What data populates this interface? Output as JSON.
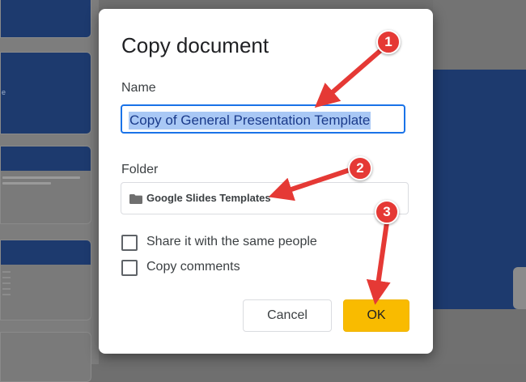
{
  "background": {
    "thumbnail_title_fragment": "e"
  },
  "dialog": {
    "title": "Copy document",
    "name_label": "Name",
    "name_value": "Copy of General Presentation Template",
    "folder_label": "Folder",
    "folder_icon": "folder-icon",
    "folder_value": "Google Slides Templates",
    "checkboxes": [
      {
        "label": "Share it with the same people",
        "checked": false
      },
      {
        "label": "Copy comments",
        "checked": false
      }
    ],
    "cancel_label": "Cancel",
    "ok_label": "OK"
  },
  "annotations": {
    "steps": [
      "1",
      "2",
      "3"
    ],
    "color": "#e53935"
  },
  "colors": {
    "accent_blue": "#1a73e8",
    "ok_yellow": "#f9bb00",
    "slide_blue": "#1d3a6e"
  }
}
